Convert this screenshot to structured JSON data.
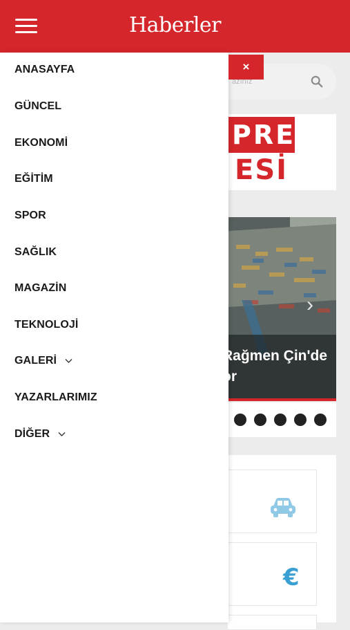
{
  "header": {
    "logo": "Haberler",
    "menu_icon": "hamburger-menu-icon",
    "background_color": "#d4262b"
  },
  "search": {
    "placeholder_fragment": "azınız",
    "icon": "search-icon"
  },
  "drawer": {
    "close_label": "×",
    "items": [
      {
        "label": "ANASAYFA",
        "has_dropdown": false
      },
      {
        "label": "GÜNCEL",
        "has_dropdown": false
      },
      {
        "label": "EKONOMİ",
        "has_dropdown": false
      },
      {
        "label": "EĞİTİM",
        "has_dropdown": false
      },
      {
        "label": "SPOR",
        "has_dropdown": false
      },
      {
        "label": "SAĞLIK",
        "has_dropdown": false
      },
      {
        "label": "MAGAZİN",
        "has_dropdown": false
      },
      {
        "label": "TEKNOLOJİ",
        "has_dropdown": false
      },
      {
        "label": "GALERİ",
        "has_dropdown": true
      },
      {
        "label": "YAZARLARIMIZ",
        "has_dropdown": false
      },
      {
        "label": "DİĞER",
        "has_dropdown": true
      }
    ]
  },
  "banner": {
    "line1": "PRES",
    "line2": "ESİ"
  },
  "slider": {
    "caption_line1": "Rağmen Çin'de",
    "caption_line2": "or",
    "next_icon": "chevron-right-icon",
    "dot_count": 5,
    "accent_color": "#d4262b"
  },
  "cards": [
    {
      "icon": "car-icon",
      "icon_color": "#8fc9e6"
    },
    {
      "icon": "euro-icon",
      "icon_color": "#3aa0d4",
      "symbol": "€"
    }
  ]
}
